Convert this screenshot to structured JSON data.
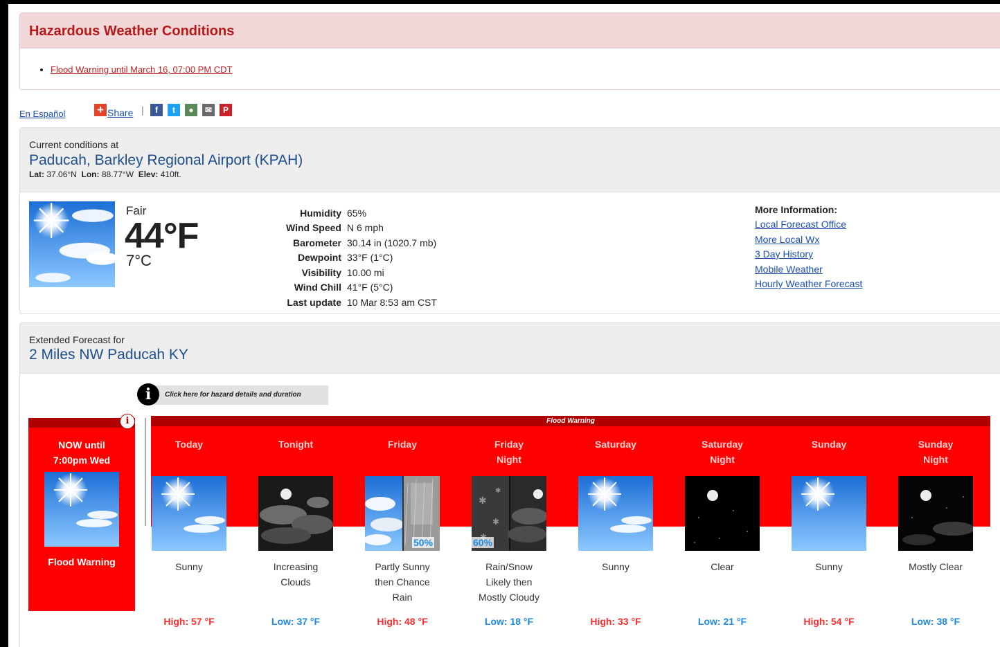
{
  "hazard": {
    "title": "Hazardous Weather Conditions",
    "items": [
      "Flood Warning until March 16, 07:00 PM CDT"
    ]
  },
  "share": {
    "espanol": "En Español",
    "share_label": "Share",
    "separator": "|",
    "social_icons": [
      "facebook-icon",
      "twitter-icon",
      "digg-icon",
      "email-icon",
      "pinterest-icon"
    ]
  },
  "current": {
    "header_label": "Current conditions at",
    "station": "Paducah, Barkley Regional Airport (KPAH)",
    "lat_label": "Lat:",
    "lat": "37.06°N",
    "lon_label": "Lon:",
    "lon": "88.77°W",
    "elev_label": "Elev:",
    "elev": "410ft.",
    "condition": "Fair",
    "temp_f": "44°F",
    "temp_c": "7°C",
    "details": [
      {
        "label": "Humidity",
        "value": "65%"
      },
      {
        "label": "Wind Speed",
        "value": "N 6 mph"
      },
      {
        "label": "Barometer",
        "value": "30.14 in (1020.7 mb)"
      },
      {
        "label": "Dewpoint",
        "value": "33°F (1°C)"
      },
      {
        "label": "Visibility",
        "value": "10.00 mi"
      },
      {
        "label": "Wind Chill",
        "value": "41°F (5°C)"
      },
      {
        "label": "Last update",
        "value": "10 Mar 8:53 am CST"
      }
    ],
    "more_info": {
      "heading": "More Information:",
      "links": [
        "Local Forecast Office",
        "More Local Wx",
        "3 Day History",
        "Mobile Weather",
        "Hourly Weather Forecast"
      ]
    }
  },
  "extended": {
    "header_label": "Extended Forecast for",
    "location": "2 Miles NW Paducah KY",
    "hazard_click": "Click here for hazard details and duration",
    "now_box": {
      "title_line1": "NOW until",
      "title_line2": "7:00pm Wed",
      "label": "Flood Warning"
    },
    "band_label": "Flood Warning",
    "periods": [
      {
        "name1": "Today",
        "name2": "",
        "desc1": "Sunny",
        "desc2": "",
        "desc3": "",
        "temp": "High: 57 °F",
        "kind": "high",
        "icon": "sunny-icon"
      },
      {
        "name1": "Tonight",
        "name2": "",
        "desc1": "Increasing",
        "desc2": "Clouds",
        "desc3": "",
        "temp": "Low: 37 °F",
        "kind": "low",
        "icon": "night-clouds-icon"
      },
      {
        "name1": "Friday",
        "name2": "",
        "desc1": "Partly Sunny",
        "desc2": "then Chance",
        "desc3": "Rain",
        "temp": "High: 48 °F",
        "kind": "high",
        "icon": "partly-sunny-rain-icon",
        "pct": "50%"
      },
      {
        "name1": "Friday",
        "name2": "Night",
        "desc1": "Rain/Snow",
        "desc2": "Likely then",
        "desc3": "Mostly Cloudy",
        "temp": "Low: 18 °F",
        "kind": "low",
        "icon": "rain-snow-icon",
        "pct": "60%"
      },
      {
        "name1": "Saturday",
        "name2": "",
        "desc1": "Sunny",
        "desc2": "",
        "desc3": "",
        "temp": "High: 33 °F",
        "kind": "high",
        "icon": "sunny-icon"
      },
      {
        "name1": "Saturday",
        "name2": "Night",
        "desc1": "Clear",
        "desc2": "",
        "desc3": "",
        "temp": "Low: 21 °F",
        "kind": "low",
        "icon": "clear-night-icon"
      },
      {
        "name1": "Sunday",
        "name2": "",
        "desc1": "Sunny",
        "desc2": "",
        "desc3": "",
        "temp": "High: 54 °F",
        "kind": "high",
        "icon": "sunny-icon"
      },
      {
        "name1": "Sunday",
        "name2": "Night",
        "desc1": "Mostly Clear",
        "desc2": "",
        "desc3": "",
        "temp": "Low: 38 °F",
        "kind": "low",
        "icon": "mostly-clear-night-icon"
      }
    ]
  },
  "colors": {
    "warning_red": "#ff0000",
    "warning_dark": "#b00000",
    "hazard_title": "#b51a1a",
    "link_blue": "#1a4fb0",
    "high_temp": "#ff2d2d",
    "low_temp": "#1e88e5"
  }
}
